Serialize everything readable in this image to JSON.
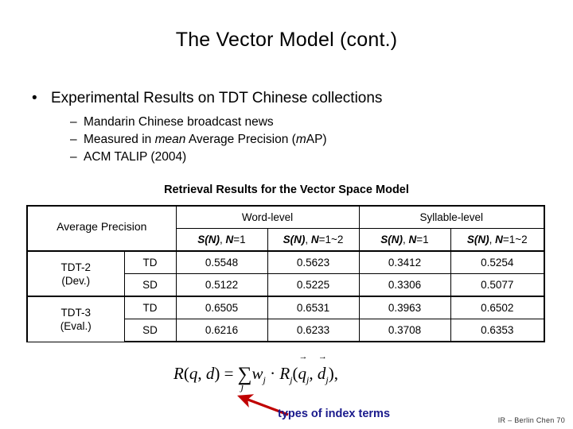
{
  "slide": {
    "title": "The Vector Model (cont.)",
    "footer": "IR – Berlin Chen 70"
  },
  "bullets": {
    "level1_marker": "•",
    "level2_marker": "–",
    "main": "Experimental Results on TDT Chinese collections",
    "sub": [
      {
        "pre": "Mandarin Chinese broadcast news",
        "italic": "",
        "post": ""
      },
      {
        "pre": "Measured in ",
        "italic": "mean",
        "post": " Average Precision (",
        "italic2": "m",
        "post2": "AP)"
      },
      {
        "pre": "ACM TALIP (2004)",
        "italic": "",
        "post": ""
      }
    ],
    "sub_plain": [
      "Mandarin Chinese broadcast news",
      "Measured in mean Average Precision (mAP)",
      "ACM TALIP (2004)"
    ]
  },
  "table": {
    "caption": "Retrieval Results for the Vector Space Model",
    "corner_label": "Average Precision",
    "group_headers": [
      "Word-level",
      "Syllable-level"
    ],
    "sub_headers": [
      {
        "sn": "S(N)",
        "sep": ", ",
        "nv": "N",
        "eq": "=1"
      },
      {
        "sn": "S(N)",
        "sep": ", ",
        "nv": "N",
        "eq": "=1~2"
      },
      {
        "sn": "S(N)",
        "sep": ", ",
        "nv": "N",
        "eq": "=1"
      },
      {
        "sn": "S(N)",
        "sep": ", ",
        "nv": "N",
        "eq": "=1~2"
      }
    ],
    "sub_headers_plain": [
      "S(N), N=1",
      "S(N), N=1~2",
      "S(N), N=1",
      "S(N), N=1~2"
    ],
    "row_groups": [
      {
        "label_line1": "TDT-2",
        "label_line2": "(Dev.)",
        "rows": [
          {
            "condition": "TD",
            "values": [
              "0.5548",
              "0.5623",
              "0.3412",
              "0.5254"
            ]
          },
          {
            "condition": "SD",
            "values": [
              "0.5122",
              "0.5225",
              "0.3306",
              "0.5077"
            ]
          }
        ]
      },
      {
        "label_line1": "TDT-3",
        "label_line2": "(Eval.)",
        "rows": [
          {
            "condition": "TD",
            "values": [
              "0.6505",
              "0.6531",
              "0.3963",
              "0.6502"
            ]
          },
          {
            "condition": "SD",
            "values": [
              "0.6216",
              "0.6233",
              "0.3708",
              "0.6353"
            ]
          }
        ]
      }
    ]
  },
  "formula": {
    "lhs_r": "R",
    "lhs_open": "(",
    "lhs_q": "q",
    "lhs_comma": ", ",
    "lhs_d": "d",
    "lhs_close": ")",
    "equals": " = ",
    "sum": "∑",
    "sum_index": "j",
    "w": "w",
    "w_sub": "j",
    "dot": " · ",
    "rj": "R",
    "rj_sub": "j",
    "open": "(",
    "vec_q": "q",
    "vec_q_sub": "j",
    "comma": ", ",
    "vec_d": "d",
    "vec_d_sub": "j",
    "close": ")",
    "trail": ",",
    "vector_arrow": "→"
  },
  "annotation": {
    "label": "types of index terms",
    "color": "#1a1a8c",
    "arrow_color": "#c00000"
  }
}
